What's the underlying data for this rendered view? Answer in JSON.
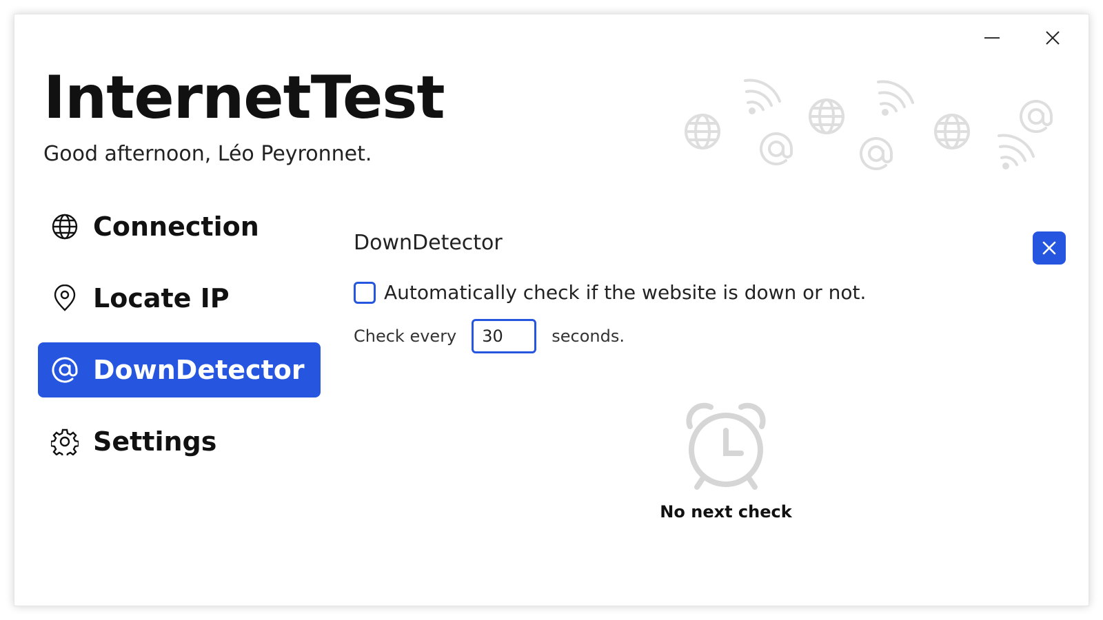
{
  "app": {
    "title": "InternetTest",
    "greeting": "Good afternoon, Léo Peyronnet."
  },
  "window_controls": {
    "minimize_icon": "minimize-icon",
    "close_icon": "close-icon"
  },
  "nav": {
    "items": [
      {
        "label": "Connection",
        "icon": "globe-icon",
        "active": false
      },
      {
        "label": "Locate IP",
        "icon": "location-pin-icon",
        "active": false
      },
      {
        "label": "DownDetector",
        "icon": "at-sign-icon",
        "active": true
      },
      {
        "label": "Settings",
        "icon": "gear-icon",
        "active": false
      }
    ]
  },
  "downdetector": {
    "title": "DownDetector",
    "auto_check_label": "Automatically check if the website is down or not.",
    "auto_check_checked": false,
    "check_every_label": "Check every",
    "interval_value": "30",
    "seconds_label": "seconds.",
    "status_icon": "alarm-clock-icon",
    "status_text": "No next check"
  },
  "colors": {
    "accent": "#2656e0",
    "text": "#111111",
    "decor": "#dddddd"
  }
}
